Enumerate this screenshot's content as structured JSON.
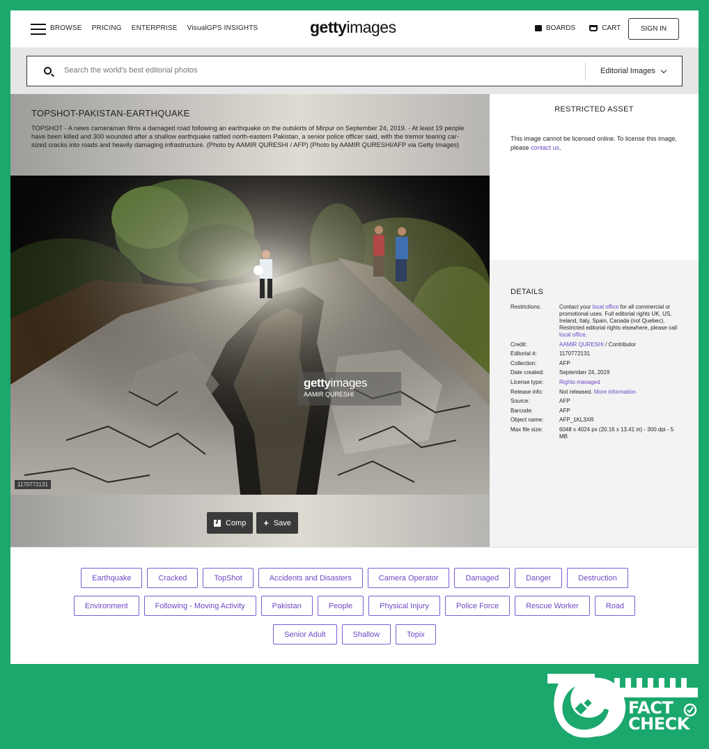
{
  "header": {
    "nav": [
      "BROWSE",
      "PRICING",
      "ENTERPRISE",
      "VisualGPS INSIGHTS"
    ],
    "logo_bold": "getty",
    "logo_light": "images",
    "boards": "BOARDS",
    "cart": "CART",
    "sign_in": "SIGN IN"
  },
  "search": {
    "placeholder": "Search the world's best editorial photos",
    "scope": "Editorial Images"
  },
  "image": {
    "title": "TOPSHOT-PAKISTAN-EARTHQUAKE",
    "caption": "TOPSHOT - A news cameraman films a damaged road following an earthquake on the outskirts of Mirpur on September 24, 2019. - At least 19 people have been killed and 300 wounded after a shallow earthquake rattled north-eastern Pakistan, a senior police officer said, with the tremor tearing car-sized cracks into roads and heavily damaging infrastructure. (Photo by AAMIR QURESHI / AFP) (Photo by AAMIR QURESHI/AFP via Getty Images)",
    "watermark_bold": "getty",
    "watermark_light": "images",
    "watermark_credit": "AAMIR QURESHI",
    "id_tag": "1170772131",
    "comp_label": "Comp",
    "save_label": "Save"
  },
  "restricted": {
    "title": "RESTRICTED ASSET",
    "text": "This image cannot be licensed online. To license this image, please ",
    "link": "contact us",
    "end": "."
  },
  "details": {
    "title": "DETAILS",
    "restrictions_label": "Restrictions:",
    "restrictions_1": "Contact your ",
    "restrictions_link1": "local office",
    "restrictions_2": " for all commercial or promotional uses. Full editorial rights UK, US, Ireland, Italy, Spain, Canada (not Quebec). Restricted editorial rights elsewhere, please call ",
    "restrictions_link2": "local office",
    "restrictions_3": ".",
    "credit_label": "Credit:",
    "credit_link": "AAMIR QURESHI",
    "credit_suffix": " / Contributor",
    "editorial_label": "Editorial #:",
    "editorial": "1170772131",
    "collection_label": "Collection:",
    "collection": "AFP",
    "date_label": "Date created:",
    "date": "September 24, 2019",
    "license_label": "License type:",
    "license": "Rights-managed",
    "release_label": "Release info:",
    "release": "Not released. ",
    "release_link": "More information",
    "source_label": "Source:",
    "source": "AFP",
    "barcode_label": "Barcode:",
    "barcode": "AFP",
    "object_label": "Object name:",
    "object": "AFP_1KL3XR",
    "maxsize_label": "Max file size:",
    "maxsize": "6048 x 4024 px (20.16 x 13.41 in) - 300 dpi - 5 MB"
  },
  "keywords": [
    [
      "Earthquake",
      "Cracked",
      "TopShot",
      "Accidents and Disasters",
      "Camera Operator",
      "Damaged",
      "Danger",
      "Destruction"
    ],
    [
      "Environment",
      "Following - Moving Activity",
      "Pakistan",
      "People",
      "Physical Injury",
      "Police Force",
      "Rescue Worker",
      "Road"
    ],
    [
      "Senior Adult",
      "Shallow",
      "Topix"
    ]
  ],
  "badge": {
    "line1": "FACT",
    "line2": "CHECK",
    "bg_color": "#1aa86c"
  }
}
